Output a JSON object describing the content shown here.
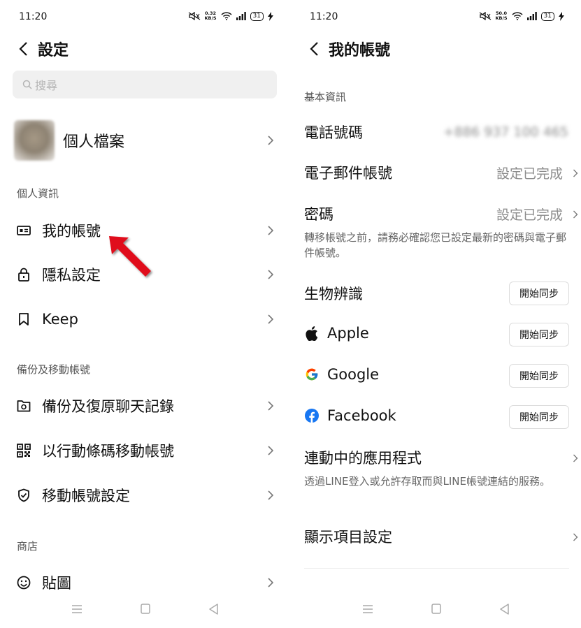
{
  "left": {
    "status": {
      "time": "11:20",
      "speed_value": "0.32",
      "speed_unit": "KB/S",
      "battery": "31"
    },
    "header": {
      "title": "設定"
    },
    "search": {
      "placeholder": "搜尋"
    },
    "profile": {
      "label": "個人檔案"
    },
    "sections": {
      "personal": "個人資訊",
      "backup": "備份及移動帳號",
      "store": "商店"
    },
    "items": {
      "my_account": "我的帳號",
      "privacy": "隱私設定",
      "keep": "Keep",
      "backup_chat": "備份及復原聊天記錄",
      "qr_transfer": "以行動條碼移動帳號",
      "transfer_settings": "移動帳號設定",
      "stickers": "貼圖"
    }
  },
  "right": {
    "status": {
      "time": "11:20",
      "speed_value": "50.0",
      "speed_unit": "KB/S",
      "battery": "31"
    },
    "header": {
      "title": "我的帳號"
    },
    "section_basic": "基本資訊",
    "phone": {
      "label": "電話號碼",
      "value": "+886 937 100 465"
    },
    "email": {
      "label": "電子郵件帳號",
      "value": "設定已完成"
    },
    "password": {
      "label": "密碼",
      "value": "設定已完成"
    },
    "password_note": "轉移帳號之前，請務必確認您已設定最新的密碼與電子郵件帳號。",
    "biometrics": {
      "label": "生物辨識",
      "button": "開始同步"
    },
    "apple": {
      "label": "Apple",
      "button": "開始同步"
    },
    "google": {
      "label": "Google",
      "button": "開始同步"
    },
    "facebook": {
      "label": "Facebook",
      "button": "開始同步"
    },
    "linked_apps": {
      "label": "連動中的應用程式",
      "note": "透過LINE登入或允許存取而與LINE帳號連結的服務。"
    },
    "display_settings": {
      "label": "顯示項目設定"
    }
  },
  "colors": {
    "arrow": "#e0111c",
    "facebook": "#1877f2"
  }
}
